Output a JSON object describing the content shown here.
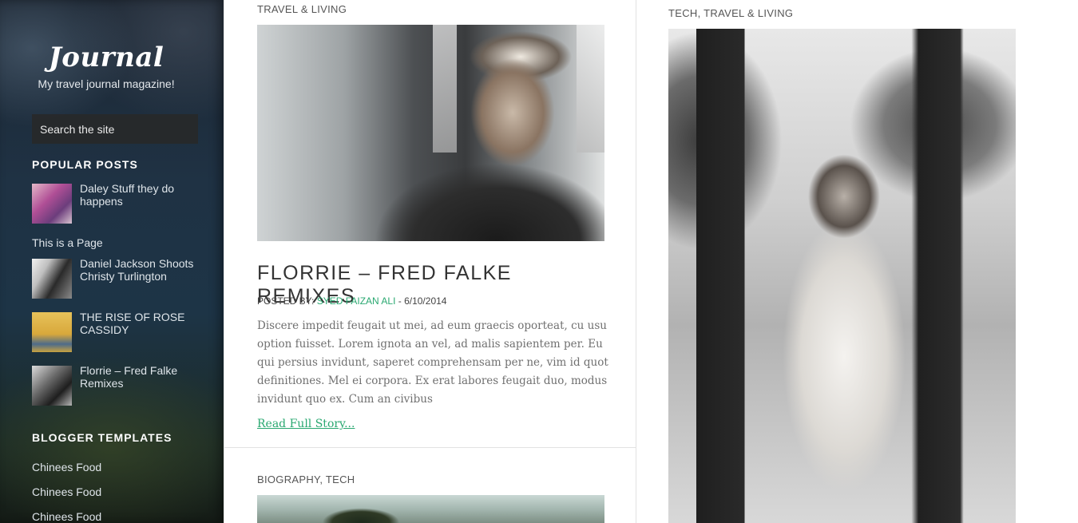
{
  "sidebar": {
    "brand_title": "Journal",
    "tagline": "My travel journal magazine!",
    "search_placeholder": "Search the site",
    "popular_posts_title": "POPULAR POSTS",
    "popular_posts": [
      {
        "label": "Daley Stuff they do happens"
      },
      {
        "label": "Daniel Jackson Shoots Christy Turlington"
      },
      {
        "label": "THE RISE OF ROSE CASSIDY"
      },
      {
        "label": "Florrie – Fred Falke Remixes"
      }
    ],
    "page_link": "This is a Page",
    "blogger_templates_title": "BLOGGER TEMPLATES",
    "blogger_templates": [
      "Chinees Food",
      "Chinees Food",
      "Chinees Food"
    ]
  },
  "main": {
    "post1": {
      "categories": "TRAVEL & LIVING",
      "title": "FLORRIE – FRED FALKE REMIXES",
      "posted_by_label": "POSTED BY:",
      "author": "SYED FAIZAN ALI",
      "date": "- 6/10/2014",
      "excerpt": "Discere impedit feugait ut mei, ad eum graecis oporteat, cu usu option fuisset. Lorem ignota an vel, ad malis sapientem per. Eu qui persius invidunt, saperet comprehensam per ne, vim id quot definitiones. Mel ei corpora. Ex erat labores feugait duo, modus invidunt quo ex. Cum an civibus",
      "read_more": "Read Full Story..."
    },
    "post2": {
      "categories": "BIOGRAPHY, TECH"
    }
  },
  "right": {
    "post": {
      "categories": "TECH, TRAVEL & LIVING"
    }
  },
  "colors": {
    "accent": "#2aa871",
    "sidebar_bg": "#1f3244"
  }
}
